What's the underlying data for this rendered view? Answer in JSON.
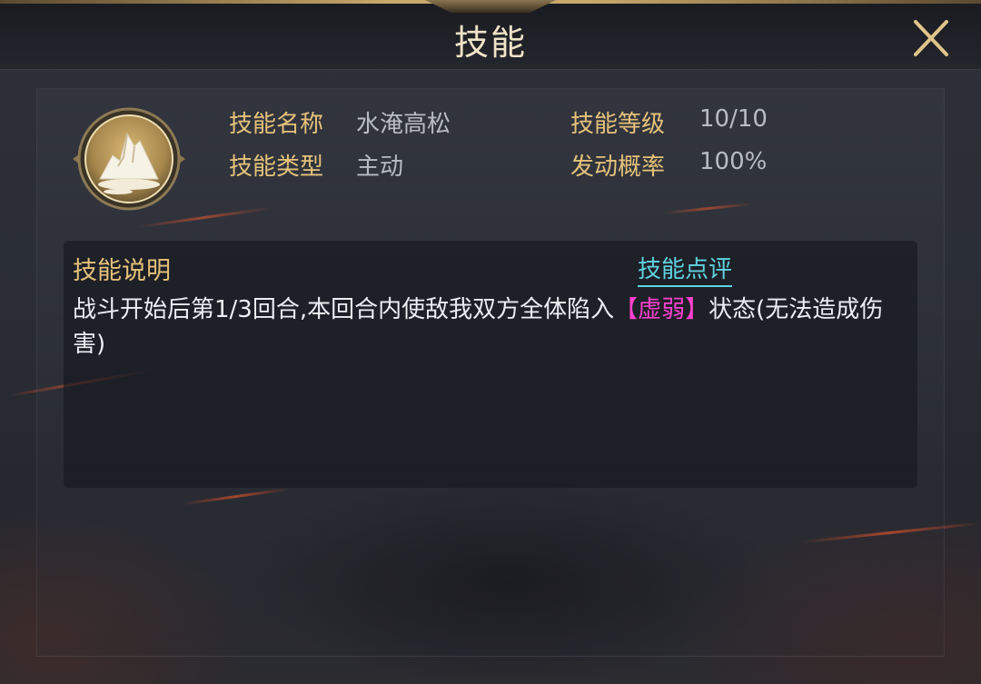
{
  "window": {
    "title": "技能",
    "close_icon": "close-icon"
  },
  "skill": {
    "emblem_icon": "mountain-emblem-icon",
    "name_label": "技能名称",
    "name_value": "水淹高松",
    "level_label": "技能等级",
    "level_value": "10/10",
    "type_label": "技能类型",
    "type_value": "主动",
    "rate_label": "发动概率",
    "rate_value": "100%"
  },
  "description": {
    "title": "技能说明",
    "review_link": "技能点评",
    "text_part1": "战斗开始后第1/3回合,本回合内使敌我双方全体陷入",
    "text_highlight": "【虚弱】",
    "text_part2": "状态(无法造成伤害)"
  },
  "colors": {
    "label_gold": "#e6c27a",
    "value_gray": "#b9bcc4",
    "link_cyan": "#5fd3e0",
    "debuff_magenta": "#ff40d0"
  }
}
